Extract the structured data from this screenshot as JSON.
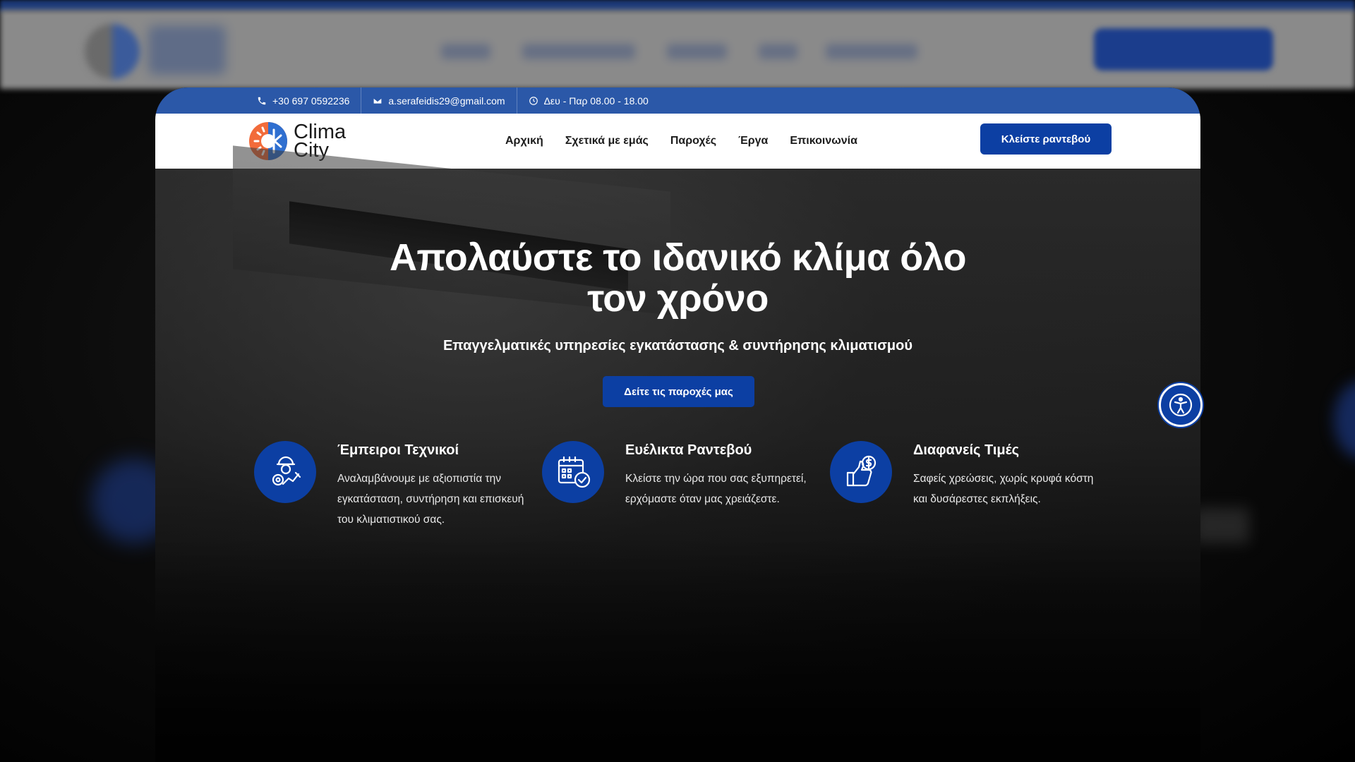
{
  "topbar": {
    "phone": "+30 697 0592236",
    "email": "a.serafeidis29@gmail.com",
    "hours": "Δευ - Παρ 08.00 - 18.00"
  },
  "logo": {
    "line1": "Clima",
    "line2": "City"
  },
  "nav": [
    {
      "label": "Αρχική"
    },
    {
      "label": "Σχετικά με εμάς"
    },
    {
      "label": "Παροχές"
    },
    {
      "label": "Έργα"
    },
    {
      "label": "Επικοινωνία"
    }
  ],
  "header_cta": "Κλείστε ραντεβού",
  "hero": {
    "title_line1": "Απολαύστε το ιδανικό κλίμα όλο",
    "title_line2": "τον χρόνο",
    "subtitle": "Επαγγελματικές υπηρεσίες εγκατάστασης & συντήρησης κλιματισμού",
    "cta": "Δείτε τις παροχές μας"
  },
  "features": [
    {
      "icon": "technician-icon",
      "title": "Έμπειροι Τεχνικοί",
      "text": "Αναλαμβάνουμε με αξιοπιστία την εγκατάσταση, συντήρηση και επισκευή του κλιματιστικού σας."
    },
    {
      "icon": "calendar-icon",
      "title": "Ευέλικτα Ραντεβού",
      "text": "Κλείστε την ώρα που σας εξυπηρετεί, ερχόμαστε όταν μας χρειάζεστε."
    },
    {
      "icon": "thumbs-up-dollar-icon",
      "title": "Διαφανείς Τιμές",
      "text": "Σαφείς χρεώσεις, χωρίς κρυφά κόστη και δυσάρεστες εκπλήξεις."
    }
  ],
  "colors": {
    "primary": "#0c3fa3",
    "topbar": "#2b58a8",
    "logo_orange": "#f26b3a",
    "logo_blue": "#2f6fd0"
  }
}
